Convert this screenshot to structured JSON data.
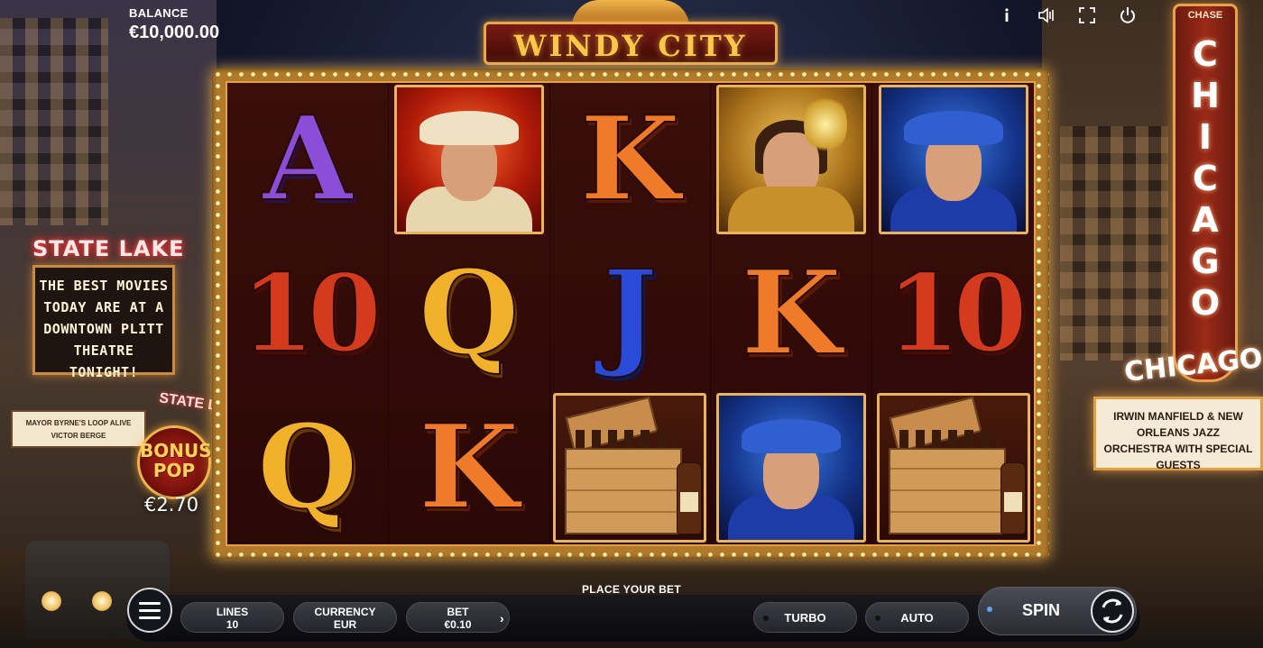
{
  "header": {
    "balance_label": "BALANCE",
    "balance_value": "€10,000.00",
    "icons": [
      "info-icon",
      "sound-icon",
      "fullscreen-icon",
      "power-icon"
    ]
  },
  "logo": {
    "text": "WINDY CITY"
  },
  "background": {
    "state_lake_sign": "STATE LAKE",
    "marquee_lines": [
      "THE BEST MOVIES",
      "TODAY ARE AT A",
      "DOWNTOWN PLITT",
      "THEATRE TONIGHT!"
    ],
    "left_marquee_lines": [
      "MAYOR BYRNE'S LOOP ALIVE",
      "VICTOR BERGE"
    ],
    "state_lake_small": "STATE LAKE",
    "chicago_vertical": "CHICAGO",
    "chase_label": "CHASE",
    "chicago_horizontal": "CHICAGO",
    "right_marquee_lines": [
      "IRWIN MANFIELD & NEW ORLEANS JAZZ",
      "ORCHESTRA WITH SPECIAL GUESTS"
    ]
  },
  "bonus_pop": {
    "line1": "BONUS",
    "line2": "POP",
    "amount": "€2.70"
  },
  "reels": [
    [
      {
        "symbol": "A",
        "color": "purple"
      },
      {
        "symbol": "10",
        "color": "red"
      },
      {
        "symbol": "Q",
        "color": "gold"
      }
    ],
    [
      {
        "symbol": "mob-boss"
      },
      {
        "symbol": "Q",
        "color": "gold"
      },
      {
        "symbol": "K",
        "color": "orange"
      }
    ],
    [
      {
        "symbol": "K",
        "color": "orange"
      },
      {
        "symbol": "J",
        "color": "blue"
      },
      {
        "symbol": "whisky-crate"
      }
    ],
    [
      {
        "symbol": "flapper-lady"
      },
      {
        "symbol": "K",
        "color": "orange"
      },
      {
        "symbol": "gangster-blue"
      }
    ],
    [
      {
        "symbol": "gangster-blue"
      },
      {
        "symbol": "10",
        "color": "red"
      },
      {
        "symbol": "whisky-crate"
      }
    ]
  ],
  "bottom_bar": {
    "place_bet": "PLACE YOUR BET",
    "lines_label": "LINES",
    "lines_value": "10",
    "currency_label": "CURRENCY",
    "currency_value": "EUR",
    "bet_label": "BET",
    "bet_value": "€0.10",
    "chevron": "›",
    "turbo_label": "TURBO",
    "auto_label": "AUTO",
    "spin_label": "SPIN"
  },
  "colors": {
    "purple": "#8a4ed8",
    "orange": "#ef7a2a",
    "red": "#d43a1e",
    "gold": "#f2b12a",
    "blue": "#2a4ad8"
  }
}
